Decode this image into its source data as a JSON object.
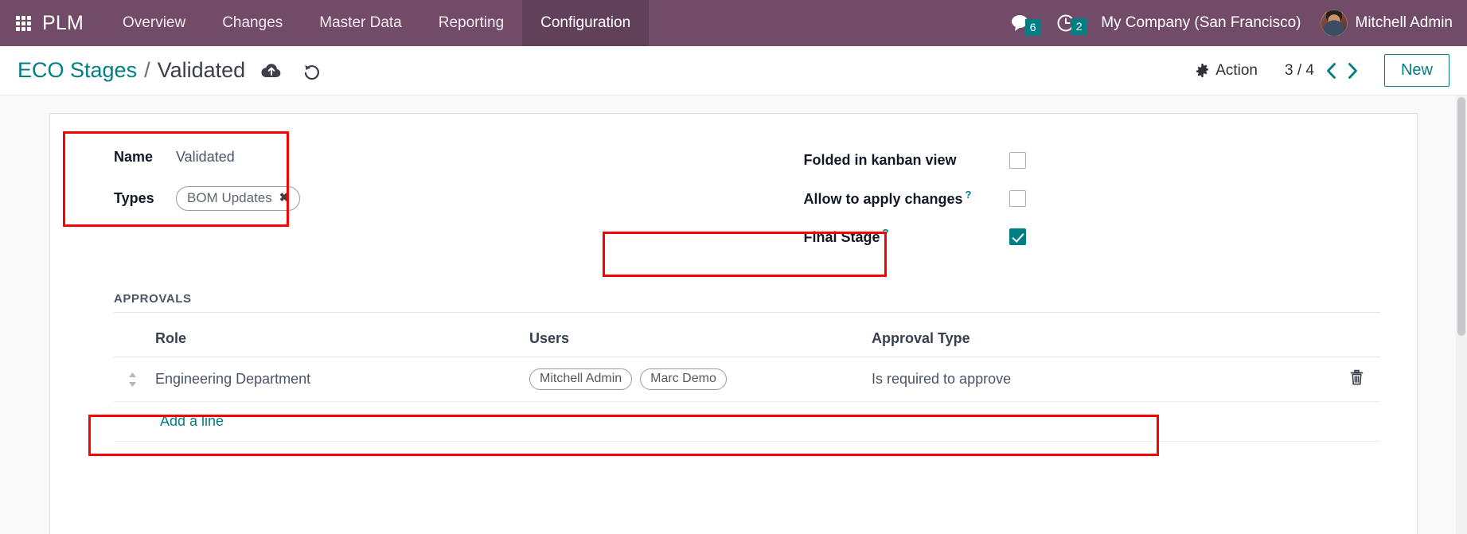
{
  "navbar": {
    "apps_icon": "apps-grid-icon",
    "brand": "PLM",
    "menu_items": [
      {
        "label": "Overview",
        "active": false
      },
      {
        "label": "Changes",
        "active": false
      },
      {
        "label": "Master Data",
        "active": false
      },
      {
        "label": "Reporting",
        "active": false
      },
      {
        "label": "Configuration",
        "active": true
      }
    ],
    "messages": {
      "icon": "messages-icon",
      "count": "6"
    },
    "activities": {
      "icon": "activity-clock-icon",
      "count": "2"
    },
    "company": "My Company (San Francisco)",
    "user": "Mitchell Admin",
    "avatar_icon": "user-avatar",
    "bg_color": "#714b67",
    "badge_color": "#017e84"
  },
  "control_panel": {
    "breadcrumb_parent": "ECO Stages",
    "breadcrumb_separator": "/",
    "breadcrumb_current": "Validated",
    "save_icon": "cloud-upload-save-icon",
    "discard_icon": "undo-discard-icon",
    "action_label": "Action",
    "action_icon": "gear-icon",
    "pager": "3 / 4",
    "pager_prev_icon": "chevron-left-icon",
    "pager_next_icon": "chevron-right-icon",
    "new_label": "New",
    "accent_color": "#017e84"
  },
  "form": {
    "left": {
      "name_label": "Name",
      "name_value": "Validated",
      "types_label": "Types",
      "types_tags": [
        {
          "label": "BOM Updates",
          "remove_icon": "tag-remove-icon"
        }
      ]
    },
    "right": {
      "folded_label": "Folded in kanban view",
      "folded_checked": false,
      "allow_label": "Allow to apply changes",
      "allow_tooltip": "?",
      "allow_checked": false,
      "final_label": "Final Stage",
      "final_tooltip": "?",
      "final_checked": true
    }
  },
  "approvals": {
    "title": "APPROVALS",
    "columns": [
      "Role",
      "Users",
      "Approval Type"
    ],
    "rows": [
      {
        "handle_icon": "drag-handle-icon",
        "role": "Engineering Department",
        "users": [
          "Mitchell Admin",
          "Marc Demo"
        ],
        "approval_type": "Is required to approve",
        "delete_icon": "trash-icon"
      }
    ],
    "add_line_label": "Add a line"
  },
  "annotations": {
    "highlight_color": "#ff0000",
    "boxes": [
      "name-and-types",
      "final-stage",
      "approval-row"
    ]
  }
}
